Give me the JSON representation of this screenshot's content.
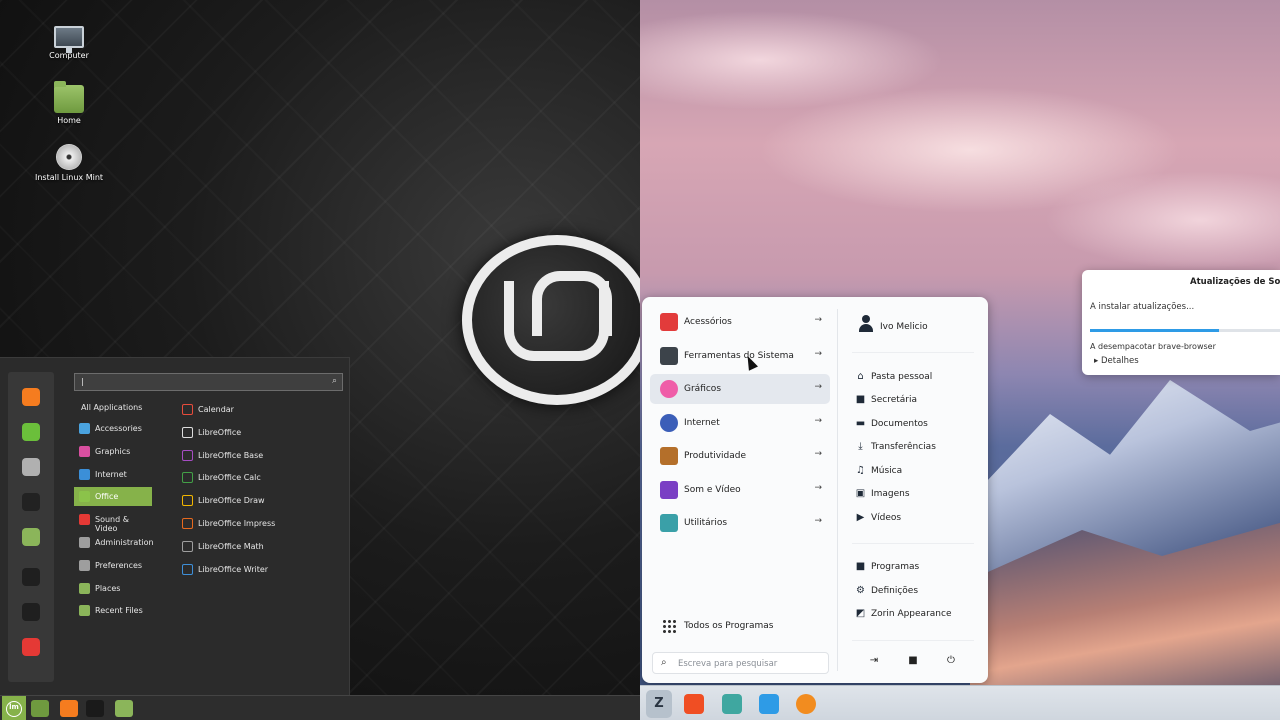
{
  "mint": {
    "desktop_icons": [
      {
        "label": "Computer"
      },
      {
        "label": "Home"
      },
      {
        "label": "Install Linux Mint"
      }
    ],
    "search": {
      "value": "",
      "placeholder": ""
    },
    "categories": [
      {
        "label": "All Applications",
        "color": ""
      },
      {
        "label": "Accessories",
        "color": "#4aa3df"
      },
      {
        "label": "Graphics",
        "color": "#d94fa0"
      },
      {
        "label": "Internet",
        "color": "#3b8fd8"
      },
      {
        "label": "Office",
        "color": "#8bc34a"
      },
      {
        "label": "Sound & Video",
        "color": "#e53935"
      },
      {
        "label": "Administration",
        "color": "#9e9e9e"
      },
      {
        "label": "Preferences",
        "color": "#9e9e9e"
      },
      {
        "label": "Places",
        "color": "#8bb55a"
      },
      {
        "label": "Recent Files",
        "color": "#8bb55a"
      }
    ],
    "active_category": "Office",
    "apps": [
      {
        "label": "Calendar",
        "color": "#e74c3c"
      },
      {
        "label": "LibreOffice",
        "color": "#dddddd"
      },
      {
        "label": "LibreOffice Base",
        "color": "#a64dc3"
      },
      {
        "label": "LibreOffice Calc",
        "color": "#43a047"
      },
      {
        "label": "LibreOffice Draw",
        "color": "#f2b600"
      },
      {
        "label": "LibreOffice Impress",
        "color": "#e66a1f"
      },
      {
        "label": "LibreOffice Math",
        "color": "#9e9e9e"
      },
      {
        "label": "LibreOffice Writer",
        "color": "#3e8fd8"
      }
    ],
    "favorites": [
      {
        "icon": "firefox-icon",
        "color": "#f57c1f"
      },
      {
        "icon": "software-manager-icon",
        "color": "#6bbf3b"
      },
      {
        "icon": "settings-icon",
        "color": "#b0b0b0"
      },
      {
        "icon": "terminal-icon",
        "color": "#222222"
      },
      {
        "icon": "files-icon",
        "color": "#8bb55a"
      },
      {
        "icon": "lock-icon",
        "color": "#1f1f1f"
      },
      {
        "icon": "logout-icon",
        "color": "#1f1f1f"
      },
      {
        "icon": "power-icon",
        "color": "#e53935"
      }
    ],
    "panel_launchers": [
      {
        "icon": "files-icon",
        "color": "#6f9a3f"
      },
      {
        "icon": "firefox-icon",
        "color": "#f57c1f"
      },
      {
        "icon": "terminal-icon",
        "color": "#1a1a1a"
      },
      {
        "icon": "folder-icon",
        "color": "#8bb55a"
      }
    ]
  },
  "zorin": {
    "categories": [
      {
        "label": "Acessórios",
        "color": "#e23b3b"
      },
      {
        "label": "Ferramentas do Sistema",
        "color": "#3c434a"
      },
      {
        "label": "Gráficos",
        "color": "#ef5da8"
      },
      {
        "label": "Internet",
        "color": "#3b5eb8"
      },
      {
        "label": "Produtividade",
        "color": "#b46f2a"
      },
      {
        "label": "Som e Vídeo",
        "color": "#7a3fc4"
      },
      {
        "label": "Utilitários",
        "color": "#3aa0a8"
      }
    ],
    "hovered_category": "Gráficos",
    "all_programs": "Todos os Programas",
    "search_placeholder": "Escreva para pesquisar",
    "user_name": "Ivo Melicio",
    "places": [
      {
        "label": "Pasta pessoal",
        "icon": "home-icon",
        "glyph": "⌂"
      },
      {
        "label": "Secretária",
        "icon": "desktop-icon",
        "glyph": "■"
      },
      {
        "label": "Documentos",
        "icon": "document-icon",
        "glyph": "▬"
      },
      {
        "label": "Transferências",
        "icon": "download-icon",
        "glyph": "⤓"
      },
      {
        "label": "Música",
        "icon": "music-icon",
        "glyph": "♫"
      },
      {
        "label": "Imagens",
        "icon": "image-icon",
        "glyph": "▣"
      },
      {
        "label": "Vídeos",
        "icon": "video-icon",
        "glyph": "▶"
      }
    ],
    "system_links": [
      {
        "label": "Programas",
        "icon": "software-icon",
        "glyph": "■"
      },
      {
        "label": "Definições",
        "icon": "settings-icon",
        "glyph": "⚙"
      },
      {
        "label": "Zorin Appearance",
        "icon": "appearance-icon",
        "glyph": "◩"
      }
    ],
    "update_dialog": {
      "title": "Atualizações de Soft",
      "status": "A instalar atualizações...",
      "progress": 0.68,
      "detail": "A desempacotar brave-browser",
      "expander": "Detalhes"
    },
    "panel_launchers": [
      {
        "icon": "brave-icon",
        "color": "#f04e23"
      },
      {
        "icon": "files-icon",
        "color": "#3fa7a0"
      },
      {
        "icon": "software-store-icon",
        "color": "#2e9be6"
      },
      {
        "icon": "updater-icon",
        "color": "#f28c1f"
      }
    ]
  }
}
